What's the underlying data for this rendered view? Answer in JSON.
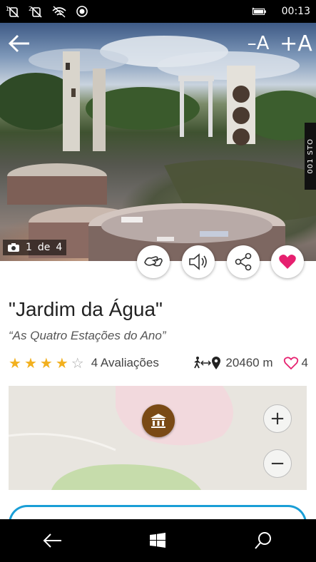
{
  "status_bar": {
    "time": "00:13",
    "icons": [
      "sim1-no-signal-icon",
      "sim2-no-signal-icon",
      "wifi-icon",
      "location-icon",
      "battery-icon"
    ]
  },
  "hero": {
    "back_icon": "back-arrow-icon",
    "font_decrease_label": "–A",
    "font_increase_label": "+A",
    "photo_counter": {
      "current": "1",
      "separator": "de",
      "total": "4"
    },
    "side_tab_label": "001 STO"
  },
  "actions": [
    {
      "name": "sign-language-button",
      "icon": "sign-language-icon"
    },
    {
      "name": "audio-button",
      "icon": "speaker-icon"
    },
    {
      "name": "share-button",
      "icon": "share-icon"
    },
    {
      "name": "favorite-button",
      "icon": "heart-icon"
    }
  ],
  "place": {
    "title": "\"Jardim da Água\"",
    "subtitle": "“As Quatro Estações do Ano”",
    "rating": 4,
    "rating_max": 5,
    "reviews_label": "4 Avaliações",
    "distance_label": "20460 m",
    "likes_count": "4"
  },
  "map": {
    "zoom_in_label": "+",
    "zoom_out_label": "−",
    "marker_icon": "museum-icon"
  },
  "colors": {
    "accent_blue": "#1a9ed6",
    "favorite_pink": "#e6206f",
    "star_gold": "#f2b01e",
    "marker_brown": "#7a4a15"
  }
}
